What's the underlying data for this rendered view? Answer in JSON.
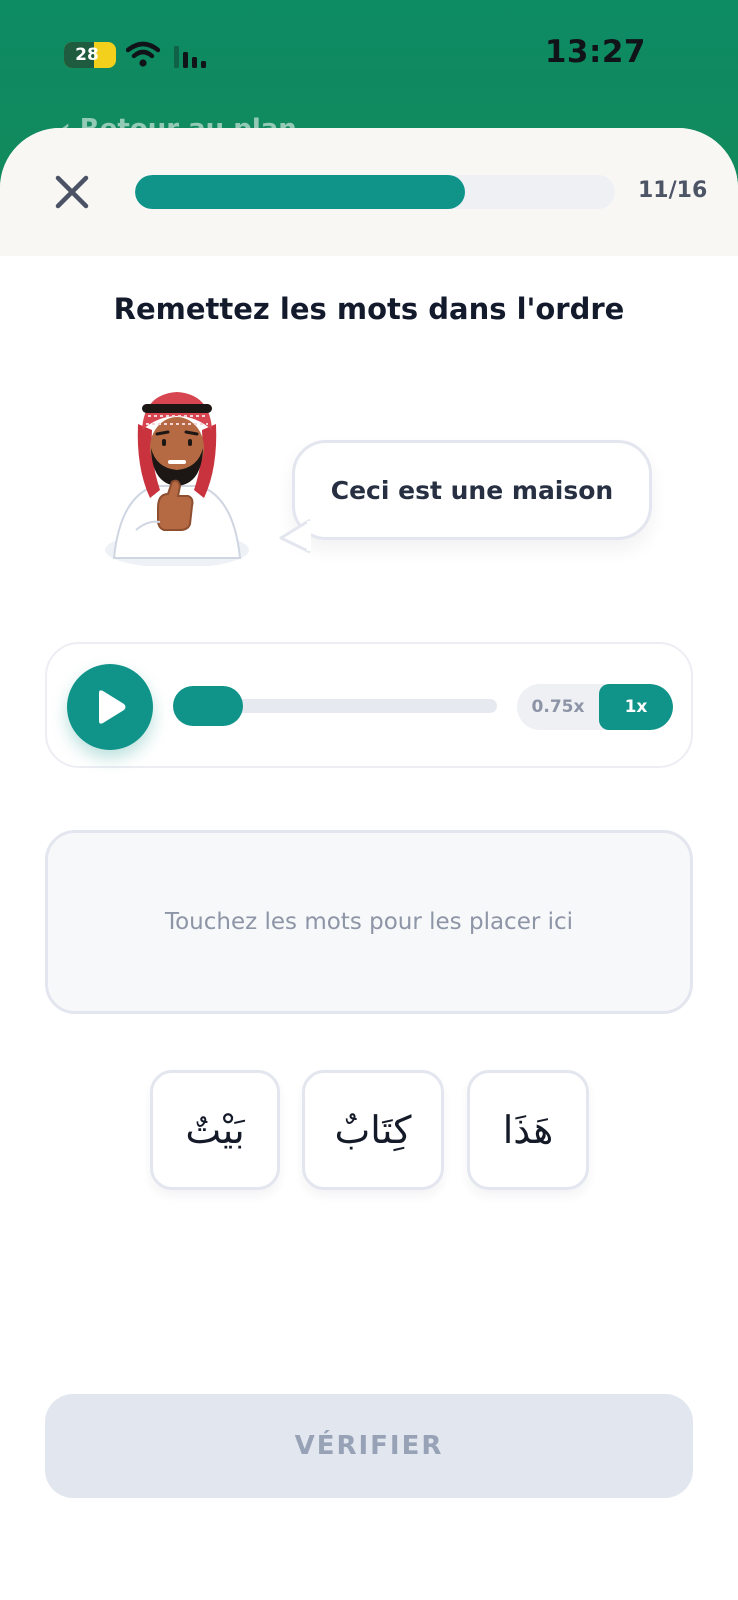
{
  "status_bar": {
    "time": "13:27",
    "battery_level": "28"
  },
  "background_header": {
    "back_label": "Retour au plan"
  },
  "lesson": {
    "progress_text": "11/16",
    "progress_fraction": 0.6875,
    "instruction": "Remettez les mots dans l'ordre"
  },
  "speech_bubble": {
    "text": "Ceci est une maison"
  },
  "audio_player": {
    "position_fraction": 0.05,
    "speed_options": [
      "0.75x",
      "1x"
    ],
    "selected_speed": "1x"
  },
  "answer_area": {
    "placeholder": "Touchez les mots pour les placer ici"
  },
  "word_bank": [
    "بَيْتٌ",
    "كِتَابٌ",
    "هَذَا"
  ],
  "verify_button": {
    "label": "VÉRIFIER",
    "enabled": false
  },
  "colors": {
    "accent": "#10948a",
    "header_green": "#0d8b63",
    "disabled": "#e2e7ef"
  }
}
